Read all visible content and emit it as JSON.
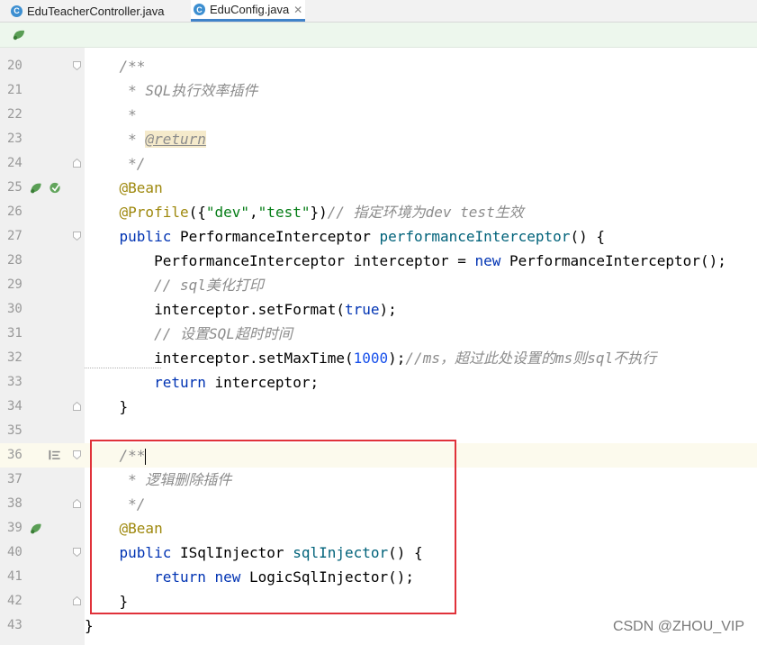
{
  "tabs": [
    {
      "icon": "C",
      "label": "EduTeacherController.java",
      "close": "✕",
      "active": false
    },
    {
      "icon": "C",
      "label": "EduConfig.java",
      "close": "✕",
      "active": true
    }
  ],
  "gutter_icons": {
    "25": [
      "bean-icon",
      "implement-override-icon"
    ],
    "36": [
      "doc-comment-icon"
    ],
    "39": [
      "bean-icon"
    ]
  },
  "lines": [
    {
      "n": "20",
      "text": "    /**"
    },
    {
      "n": "21",
      "text": "     * SQL执行效率插件"
    },
    {
      "n": "22",
      "text": "     *"
    },
    {
      "n": "23",
      "text": "     * @return"
    },
    {
      "n": "24",
      "text": "     */"
    },
    {
      "n": "25",
      "text": "    @Bean"
    },
    {
      "n": "26",
      "text": "    @Profile({\"dev\",\"test\"})// 指定环境为dev test生效"
    },
    {
      "n": "27",
      "text": "    public PerformanceInterceptor performanceInterceptor() {"
    },
    {
      "n": "28",
      "text": "        PerformanceInterceptor interceptor = new PerformanceInterceptor();"
    },
    {
      "n": "29",
      "text": "        // sql美化打印"
    },
    {
      "n": "30",
      "text": "        interceptor.setFormat(true);"
    },
    {
      "n": "31",
      "text": "        // 设置SQL超时时间"
    },
    {
      "n": "32",
      "text": "        interceptor.setMaxTime(1000);//ms，超过此处设置的ms则sql不执行"
    },
    {
      "n": "33",
      "text": "        return interceptor;"
    },
    {
      "n": "34",
      "text": "    }"
    },
    {
      "n": "35",
      "text": ""
    },
    {
      "n": "36",
      "text": "    /**"
    },
    {
      "n": "37",
      "text": "     * 逻辑删除插件"
    },
    {
      "n": "38",
      "text": "     */"
    },
    {
      "n": "39",
      "text": "    @Bean"
    },
    {
      "n": "40",
      "text": "    public ISqlInjector sqlInjector() {"
    },
    {
      "n": "41",
      "text": "        return new LogicSqlInjector();"
    },
    {
      "n": "42",
      "text": "    }"
    },
    {
      "n": "43",
      "text": "}"
    }
  ],
  "watermark": "CSDN @ZHOU_VIP",
  "colors": {
    "keyword": "#0033b3",
    "annotation": "#9e880d",
    "string": "#067d17",
    "number": "#1750eb",
    "method": "#00627a",
    "comment": "#8c8c8c",
    "highlight_box": "#e0323a"
  }
}
